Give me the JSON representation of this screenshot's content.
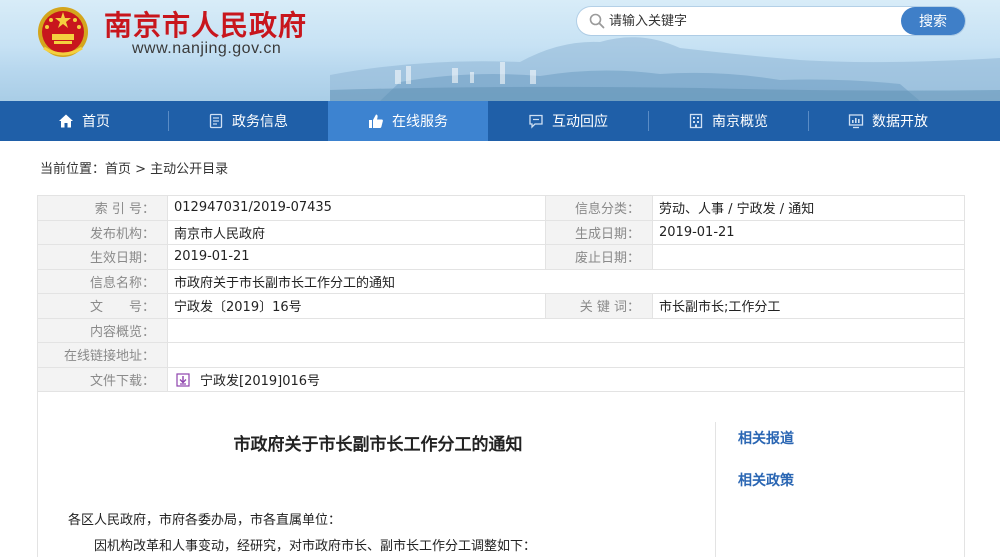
{
  "header": {
    "site_title": "南京市人民政府",
    "site_url": "www.nanjing.gov.cn",
    "search": {
      "placeholder": "请输入关键字",
      "button_label": "搜索"
    }
  },
  "nav": {
    "items": [
      {
        "label": "首页",
        "icon": "home-icon"
      },
      {
        "label": "政务信息",
        "icon": "document-icon"
      },
      {
        "label": "在线服务",
        "icon": "thumbs-up-icon",
        "active": true
      },
      {
        "label": "互动回应",
        "icon": "chat-icon"
      },
      {
        "label": "南京概览",
        "icon": "building-icon"
      },
      {
        "label": "数据开放",
        "icon": "chart-icon"
      }
    ]
  },
  "breadcrumb": {
    "text": "当前位置：首页 > 主动公开目录"
  },
  "meta": {
    "index_label": "索 引 号：",
    "index_value": "012947031/2019-07435",
    "category_label": "信息分类：",
    "category_value": "劳动、人事 / 宁政发 / 通知",
    "publisher_label": "发布机构：",
    "publisher_value": "南京市人民政府",
    "created_label": "生成日期：",
    "created_value": "2019-01-21",
    "effective_label": "生效日期：",
    "effective_value": "2019-01-21",
    "expire_label": "废止日期：",
    "expire_value": "",
    "name_label": "信息名称：",
    "name_value": "市政府关于市长副市长工作分工的通知",
    "docno_label": "文　　号：",
    "docno_value": "宁政发〔2019〕16号",
    "keywords_label": "关 键 词：",
    "keywords_value": "市长副市长;工作分工",
    "summary_label": "内容概览：",
    "summary_value": "",
    "link_label": "在线链接地址：",
    "link_value": "",
    "download_label": "文件下载：",
    "download_value": "宁政发[2019]016号"
  },
  "content": {
    "title": "市政府关于市长副市长工作分工的通知",
    "related_reports": "相关报道",
    "related_policies": "相关政策",
    "para1": "各区人民政府，市府各委办局，市各直属单位：",
    "para2": "因机构改革和人事变动，经研究，对市政府市长、副市长工作分工调整如下："
  },
  "colors": {
    "nav_bg": "#1f5fa8",
    "nav_active": "#3d83d0",
    "title_red": "#c8161d",
    "link_blue": "#2a66b3"
  }
}
